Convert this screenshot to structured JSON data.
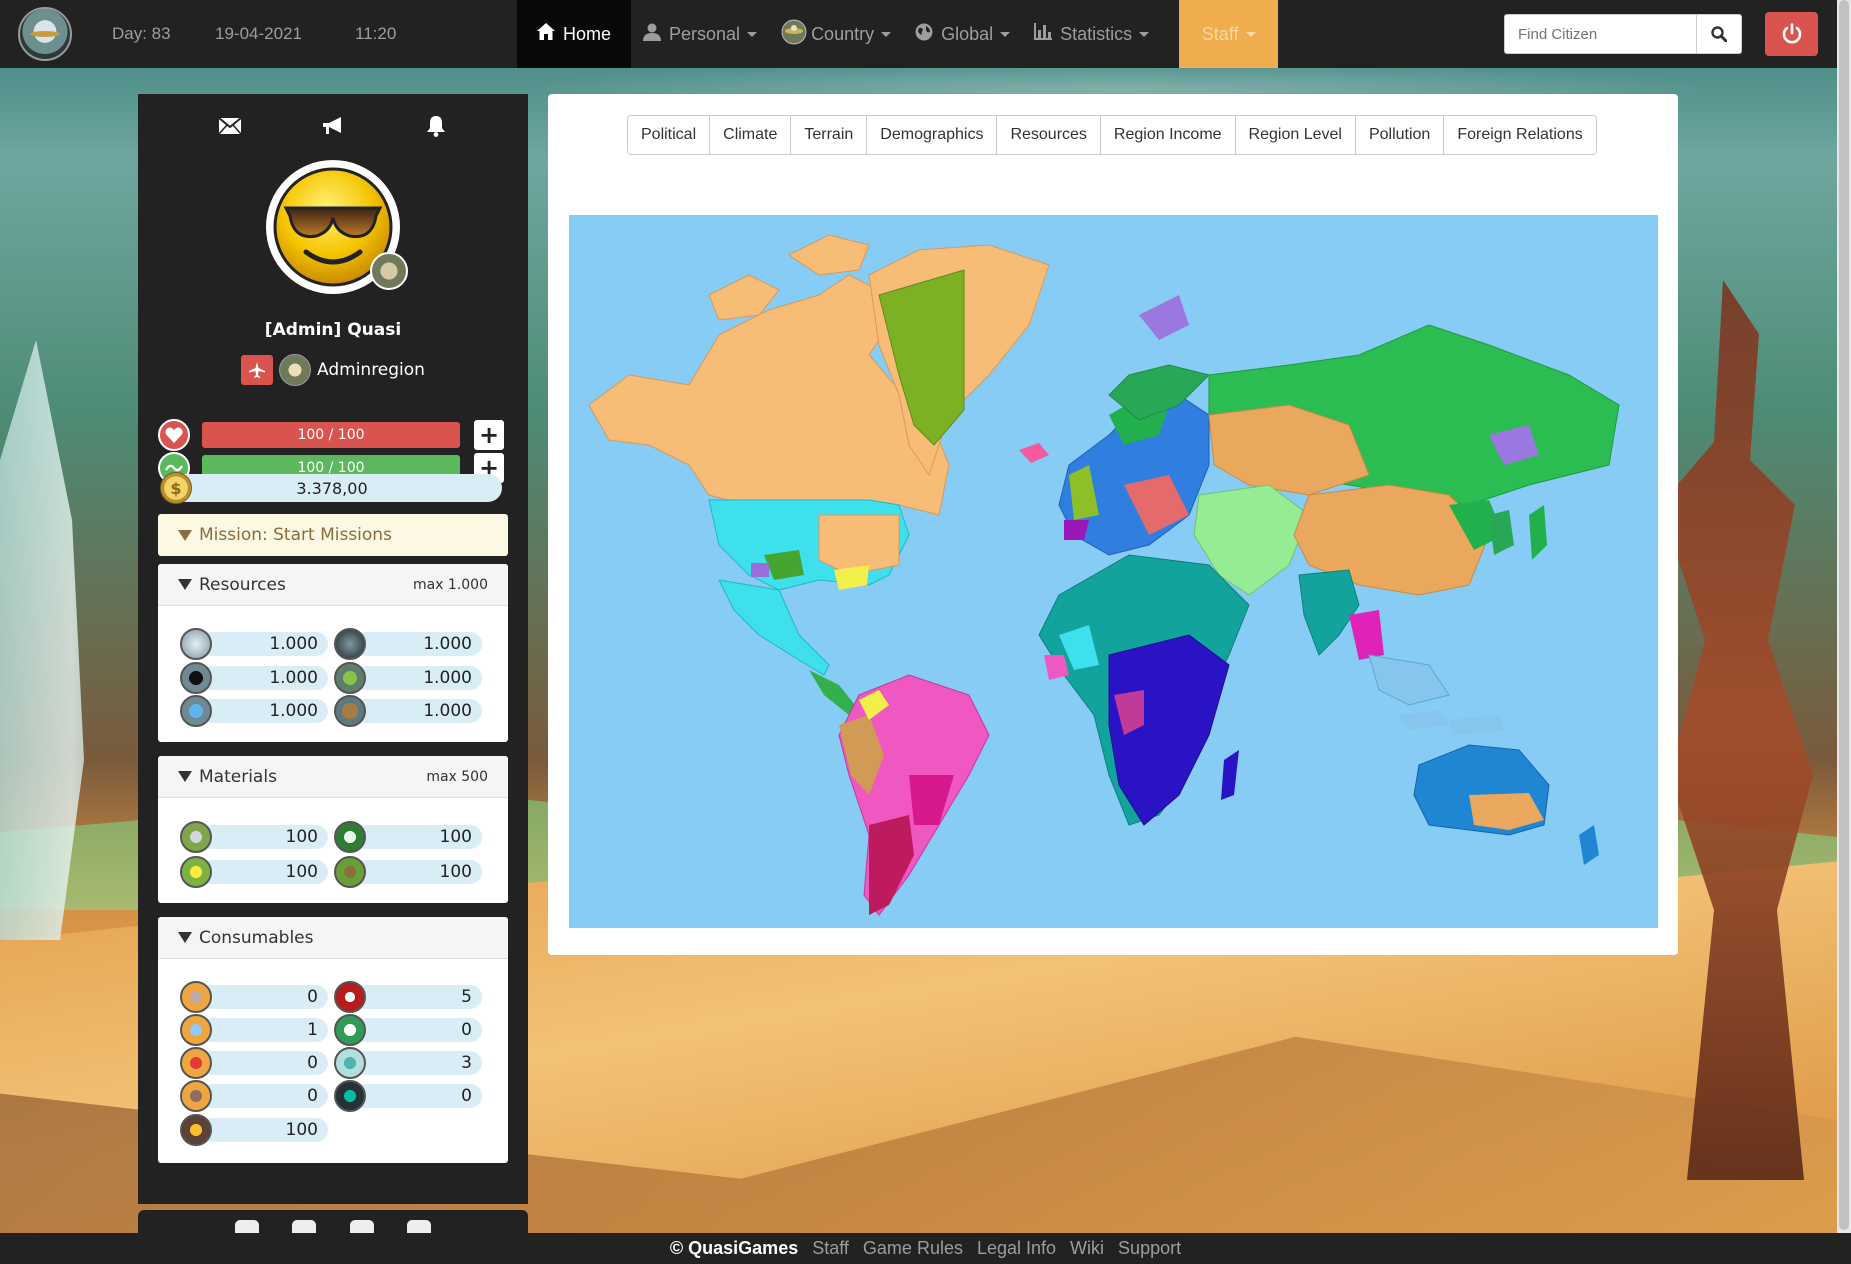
{
  "nav": {
    "day": "Day: 83",
    "date": "19-04-2021",
    "time": "11:20",
    "menu": [
      {
        "label": "Home"
      },
      {
        "label": "Personal"
      },
      {
        "label": "Country"
      },
      {
        "label": "Global"
      },
      {
        "label": "Statistics"
      },
      {
        "label": "Staff"
      }
    ],
    "search_placeholder": "Find Citizen"
  },
  "player": {
    "name": "[Admin] Quasi",
    "region": "Adminregion",
    "health": "100 / 100",
    "energy": "100 / 100",
    "money": "3.378,00",
    "mission": "Mission: Start Missions"
  },
  "resources": {
    "title": "Resources",
    "max": "max 1.000",
    "items": [
      {
        "icon": "iron-icon",
        "value": "1.000"
      },
      {
        "icon": "coal-icon",
        "value": "1.000"
      },
      {
        "icon": "oil-icon",
        "value": "1.000"
      },
      {
        "icon": "plant-icon",
        "value": "1.000"
      },
      {
        "icon": "water-icon",
        "value": "1.000"
      },
      {
        "icon": "wood-icon",
        "value": "1.000"
      }
    ]
  },
  "materials": {
    "title": "Materials",
    "max": "max 500",
    "items": [
      {
        "icon": "steel-icon",
        "value": "100"
      },
      {
        "icon": "plastic-icon",
        "value": "100"
      },
      {
        "icon": "energy-icon",
        "value": "100"
      },
      {
        "icon": "food-material-icon",
        "value": "100"
      }
    ]
  },
  "consumables": {
    "title": "Consumables",
    "items": [
      {
        "icon": "tools-icon",
        "value": "0"
      },
      {
        "icon": "package-icon",
        "value": "5"
      },
      {
        "icon": "medicine-icon",
        "value": "1"
      },
      {
        "icon": "citizen-icon",
        "value": "0"
      },
      {
        "icon": "drink-icon",
        "value": "0"
      },
      {
        "icon": "herb-icon",
        "value": "3"
      },
      {
        "icon": "meal-icon",
        "value": "0"
      },
      {
        "icon": "runner-icon",
        "value": "0"
      },
      {
        "icon": "coin-stack-icon",
        "value": "100"
      }
    ]
  },
  "map": {
    "tabs": [
      "Political",
      "Climate",
      "Terrain",
      "Demographics",
      "Resources",
      "Region Income",
      "Region Level",
      "Pollution",
      "Foreign Relations"
    ]
  },
  "footer": {
    "brand": "© QuasiGames",
    "links": [
      "Staff",
      "Game Rules",
      "Legal Info",
      "Wiki",
      "Support"
    ]
  },
  "colors": {
    "navbar": "#222222",
    "staff_accent": "#f0ad4e",
    "danger": "#d9534f",
    "health_bar": "#d9534f",
    "energy_bar": "#5cb85c",
    "ocean": "#87ccf5"
  }
}
